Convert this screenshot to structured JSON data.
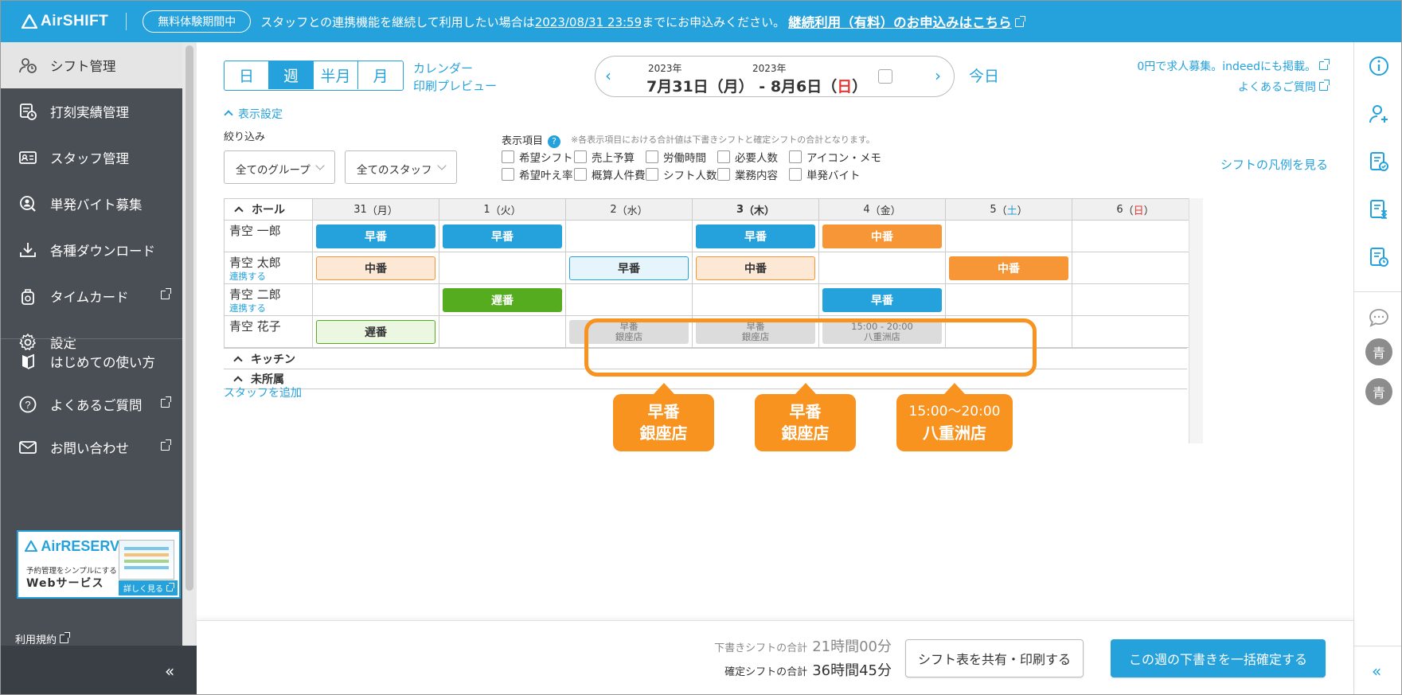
{
  "topbar": {
    "logo": "AirSHIFT",
    "trial": "無料体験期間中",
    "text_a": "スタッフとの連携機能を継続して利用したい場合は",
    "deadline": "2023/08/31 23:59",
    "text_b": "までにお申込みください。",
    "link": "継続利用（有料）のお申込みはこちら"
  },
  "sidebar": {
    "items": [
      {
        "label": "シフト管理",
        "icon": "shift-icon"
      },
      {
        "label": "打刻実績管理",
        "icon": "clock-record-icon"
      },
      {
        "label": "スタッフ管理",
        "icon": "staff-card-icon"
      },
      {
        "label": "単発バイト募集",
        "icon": "search-person-icon"
      },
      {
        "label": "各種ダウンロード",
        "icon": "download-icon"
      },
      {
        "label": "タイムカード",
        "icon": "timecard-icon"
      },
      {
        "label": "設定",
        "icon": "gear-icon"
      },
      {
        "label": "はじめての使い方",
        "icon": "book-icon"
      },
      {
        "label": "よくあるご質問",
        "icon": "question-icon"
      },
      {
        "label": "お問い合わせ",
        "icon": "mail-icon"
      }
    ],
    "ad": {
      "logo": "AirRESERVE",
      "sub": "予約管理をシンプルにする",
      "main": "Webサービス",
      "btn": "詳しく見る"
    },
    "terms": "利用規約",
    "collapse": "«"
  },
  "toolbar": {
    "views": [
      "日",
      "週",
      "半月",
      "月"
    ],
    "active_view": "週",
    "calendar": "カレンダー",
    "print_preview": "印刷プレビュー",
    "year_start": "2023年",
    "year_end": "2023年",
    "date_start": "7月31日（月）",
    "date_sep": "-",
    "date_end_prefix": "8月6日（",
    "date_end_day": "日",
    "date_end_suffix": "）",
    "today": "今日",
    "recruit_link": "0円で求人募集。indeedにも掲載。",
    "faq_link": "よくあるご質問"
  },
  "filters": {
    "display_settings": "表示設定",
    "filter_label": "絞り込み",
    "group_select": "全てのグループ",
    "staff_select": "全てのスタッフ",
    "display_items_label": "表示項目",
    "note": "※各表示項目における合計値は下書きシフトと確定シフトの合計となります。",
    "checkboxes": [
      "希望シフト",
      "売上予算",
      "労働時間",
      "必要人数",
      "アイコン・メモ",
      "希望叶え率",
      "概算人件費",
      "シフト人数",
      "業務内容",
      "単発バイト"
    ],
    "legend_link": "シフトの凡例を見る"
  },
  "table": {
    "group": "ホール",
    "days": [
      {
        "num": "31",
        "pre": "（",
        "dow": "月",
        "post": "）"
      },
      {
        "num": "1",
        "pre": "（",
        "dow": "火",
        "post": "）"
      },
      {
        "num": "2",
        "pre": "（",
        "dow": "水",
        "post": "）"
      },
      {
        "num": "3",
        "pre": "（",
        "dow": "木",
        "post": "）"
      },
      {
        "num": "4",
        "pre": "（",
        "dow": "金",
        "post": "）"
      },
      {
        "num": "5",
        "pre": "（",
        "dow": "土",
        "post": "）"
      },
      {
        "num": "6",
        "pre": "（",
        "dow": "日",
        "post": "）"
      }
    ],
    "rows": [
      {
        "name": "青空 一郎",
        "link": "",
        "shifts": [
          {
            "label": "早番",
            "style": "s-blue"
          },
          {
            "label": "早番",
            "style": "s-blue"
          },
          null,
          {
            "label": "早番",
            "style": "s-blue"
          },
          {
            "label": "中番",
            "style": "s-orange"
          },
          null,
          null
        ]
      },
      {
        "name": "青空 太郎",
        "link": "連携する",
        "shifts": [
          {
            "label": "中番",
            "style": "s-lorange"
          },
          null,
          {
            "label": "早番",
            "style": "s-lblue"
          },
          {
            "label": "中番",
            "style": "s-lorange"
          },
          null,
          {
            "label": "中番",
            "style": "s-orange"
          },
          null
        ]
      },
      {
        "name": "青空 二郎",
        "link": "連携する",
        "shifts": [
          null,
          {
            "label": "遅番",
            "style": "s-green"
          },
          null,
          null,
          {
            "label": "早番",
            "style": "s-blue"
          },
          null,
          null
        ]
      },
      {
        "name": "青空 花子",
        "link": "",
        "shifts": [
          {
            "label": "遅番",
            "style": "s-lgreen"
          },
          null,
          {
            "label": "早番",
            "sub": "銀座店",
            "style": "s-gray"
          },
          {
            "label": "早番",
            "sub": "銀座店",
            "style": "s-gray"
          },
          {
            "label": "15:00 - 20:00",
            "sub": "八重洲店",
            "style": "s-gray"
          },
          null,
          null
        ]
      }
    ],
    "sub_groups": [
      "キッチン",
      "未所属"
    ],
    "add_staff": "スタッフを追加"
  },
  "callouts": [
    {
      "line1": "早番",
      "line2": "銀座店"
    },
    {
      "line1": "早番",
      "line2": "銀座店"
    },
    {
      "line1": "15:00〜20:00",
      "line2": "八重洲店"
    }
  ],
  "footer": {
    "draft_label": "下書きシフトの合計",
    "draft_value": "21時間00分",
    "confirmed_label": "確定シフトの合計",
    "confirmed_value": "36時間45分",
    "share_button": "シフト表を共有・印刷する",
    "confirm_button": "この週の下書きを一括確定する"
  },
  "rail": {
    "icons": [
      "info-icon",
      "add-user-icon",
      "doc-check-icon",
      "doc-hourglass-icon",
      "doc-time-icon",
      "chat-icon"
    ],
    "avatars": [
      "青",
      "青"
    ],
    "collapse": "«"
  },
  "colors": {
    "brand": "#25a2dc",
    "early": "#25a2dc",
    "middle": "#f79637",
    "late": "#55ac1f",
    "annotation": "#f7931e"
  }
}
